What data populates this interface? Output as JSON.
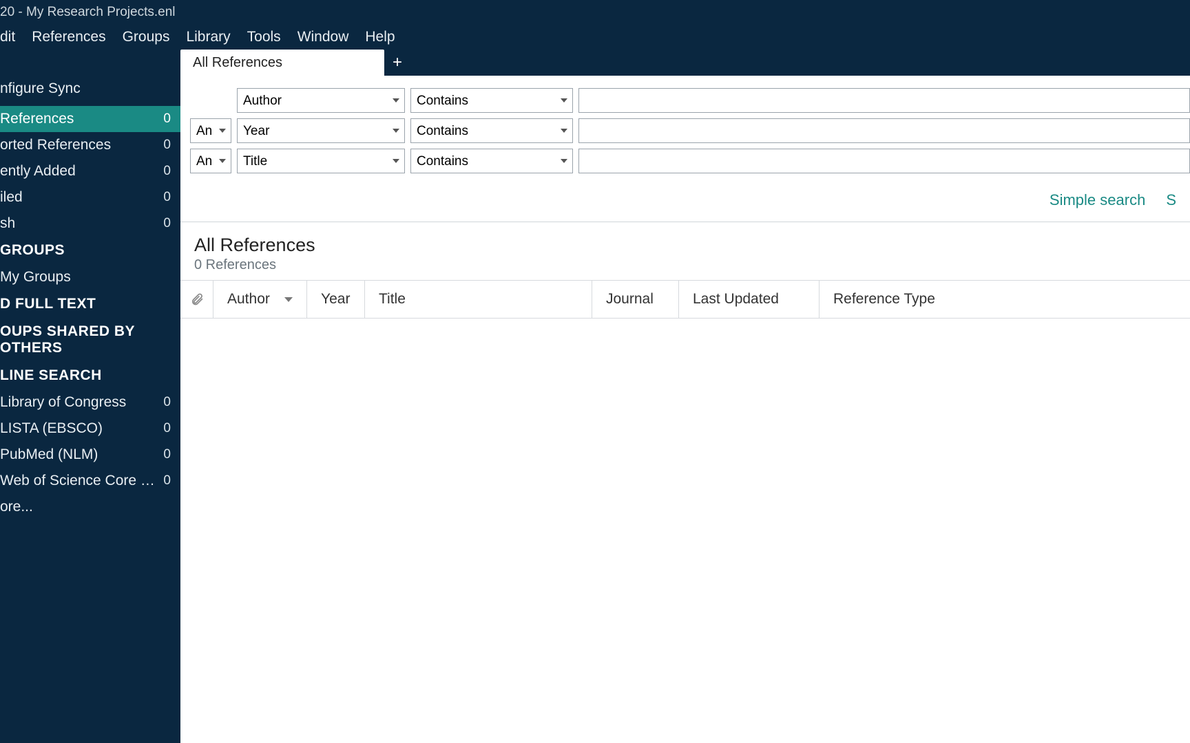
{
  "window": {
    "title": "20 - My Research Projects.enl"
  },
  "menu": [
    "dit",
    "References",
    "Groups",
    "Library",
    "Tools",
    "Window",
    "Help"
  ],
  "sidebar": {
    "configure_sync": "nfigure Sync",
    "items": [
      {
        "label": "References",
        "count": "0",
        "selected": true
      },
      {
        "label": "orted References",
        "count": "0"
      },
      {
        "label": "ently Added",
        "count": "0"
      },
      {
        "label": "iled",
        "count": "0"
      },
      {
        "label": "sh",
        "count": "0"
      }
    ],
    "sections": {
      "groups": "GROUPS",
      "my_groups": "My Groups",
      "find_full_text": "D FULL TEXT",
      "shared": "OUPS SHARED BY OTHERS",
      "online_search": "LINE SEARCH"
    },
    "online": [
      {
        "label": "Library of Congress",
        "count": "0"
      },
      {
        "label": "LISTA (EBSCO)",
        "count": "0"
      },
      {
        "label": "PubMed (NLM)",
        "count": "0"
      },
      {
        "label": "Web of Science Core Colle...",
        "count": "0"
      }
    ],
    "more": "ore..."
  },
  "tabs": {
    "active": "All References",
    "add": "+"
  },
  "search": {
    "rows": [
      {
        "bool": "",
        "field": "Author",
        "op": "Contains",
        "value": ""
      },
      {
        "bool": "And",
        "field": "Year",
        "op": "Contains",
        "value": ""
      },
      {
        "bool": "And",
        "field": "Title",
        "op": "Contains",
        "value": ""
      }
    ],
    "simple": "Simple search",
    "truncated_right": "S"
  },
  "results": {
    "heading": "All References",
    "subheading": "0 References",
    "columns": {
      "attach": "",
      "author": "Author",
      "year": "Year",
      "title": "Title",
      "journal": "Journal",
      "updated": "Last Updated",
      "type": "Reference Type"
    }
  }
}
